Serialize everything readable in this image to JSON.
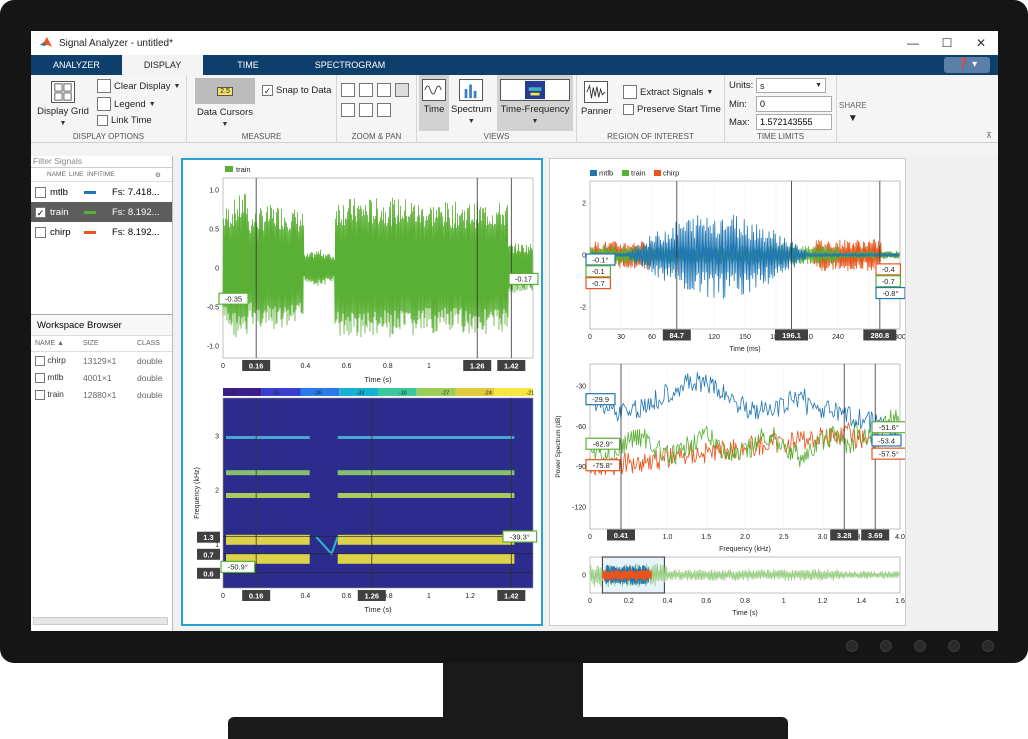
{
  "window": {
    "title": "Signal Analyzer - untitled*"
  },
  "tabs": [
    {
      "label": "ANALYZER"
    },
    {
      "label": "DISPLAY"
    },
    {
      "label": "TIME"
    },
    {
      "label": "SPECTROGRAM"
    }
  ],
  "ribbon": {
    "display_grid": "Display Grid",
    "clear_display": "Clear Display",
    "legend": "Legend",
    "link_time": "Link Time",
    "display_options": "DISPLAY OPTIONS",
    "data_cursors": "Data Cursors",
    "snap_to_data": "Snap to Data",
    "cursor_icon_value": "2.5",
    "measure": "MEASURE",
    "zoom_pan": "ZOOM & PAN",
    "time": "Time",
    "spectrum": "Spectrum",
    "time_frequency": "Time-Frequency",
    "views": "VIEWS",
    "panner": "Panner",
    "extract_signals": "Extract Signals",
    "preserve_start_time": "Preserve Start Time",
    "roi": "REGION OF INTEREST",
    "units_label": "Units:",
    "units_value": "s",
    "min_label": "Min:",
    "min_value": "0",
    "max_label": "Max:",
    "max_value": "1.572143555",
    "time_limits": "TIME LIMITS",
    "share": "SHARE"
  },
  "signals": {
    "filter_placeholder": "Filter Signals",
    "headers": [
      "NAME",
      "LINE",
      "INFO",
      "TIME"
    ],
    "rows": [
      {
        "name": "mtlb",
        "time": "Fs: 7.418...",
        "color": "#1f77b4",
        "checked": false
      },
      {
        "name": "train",
        "time": "Fs: 8.192...",
        "color": "#5ab034",
        "checked": true
      },
      {
        "name": "chirp",
        "time": "Fs: 8.192...",
        "color": "#e8541b",
        "checked": false
      }
    ]
  },
  "workspace": {
    "title": "Workspace Browser",
    "headers": [
      "NAME ▲",
      "SIZE",
      "CLASS"
    ],
    "rows": [
      {
        "name": "chirp",
        "size": "13129×1",
        "class": "double"
      },
      {
        "name": "mtlb",
        "size": "4001×1",
        "class": "double"
      },
      {
        "name": "train",
        "size": "12880×1",
        "class": "double"
      }
    ]
  },
  "plots": {
    "train_time": {
      "legend": "train",
      "xlabel": "Time (s)",
      "yticks": [
        "1.0",
        "0.5",
        "0",
        "-0.5",
        "-1.0"
      ],
      "xticks": [
        "0",
        "0.2",
        "0.4",
        "0.6",
        "0.8",
        "1",
        "1.2",
        "1.4"
      ],
      "cursor_labels": [
        "0.16",
        "1.26",
        "1.42"
      ],
      "value_labels": [
        "-0.35",
        "-0.17"
      ]
    },
    "spectrogram": {
      "xlabel": "Time (s)",
      "ylabel": "Frequency (kHz)",
      "colorbar_ticks": [
        "-42",
        "-39",
        "-36",
        "-33",
        "-30",
        "-27",
        "-24",
        "-21"
      ],
      "yticks": [
        "3",
        "2",
        "1"
      ],
      "xticks": [
        "0",
        "0.2",
        "0.4",
        "0.6",
        "0.8",
        "1",
        "1.2",
        "1.4"
      ],
      "cursor_x": [
        "0.16",
        "1.26",
        "1.42"
      ],
      "cursor_y": [
        "1.3",
        "0.7",
        "0.6"
      ],
      "value_labels": [
        "-50.9°",
        "-39.3°"
      ]
    },
    "multi_time": {
      "legend": [
        "mtlb",
        "train",
        "chirp"
      ],
      "xlabel": "Time (ms)",
      "yticks": [
        "2",
        "0",
        "-2"
      ],
      "xticks": [
        "0",
        "30",
        "60",
        "90",
        "120",
        "150",
        "180",
        "210",
        "240",
        "270",
        "300"
      ],
      "cursor_labels": [
        "84.7",
        "196.1",
        "280.8"
      ],
      "left_values": [
        "-0.1°",
        "-0.1",
        "-0.7"
      ],
      "right_values": [
        "-0.4",
        "-0.7",
        "-0.8°"
      ]
    },
    "spectrum": {
      "ylabel": "Power Spectrum (dB)",
      "xlabel": "Frequency (kHz)",
      "yticks": [
        "-30",
        "-60",
        "-90",
        "-120"
      ],
      "xticks": [
        "0",
        "0.5",
        "1.0",
        "1.5",
        "2.0",
        "2.5",
        "3.0",
        "3.5",
        "4.0"
      ],
      "cursor_labels": [
        "0.41",
        "3.28",
        "3.69"
      ],
      "left_values": [
        "-29.9",
        "-62.9°",
        "-75.8°"
      ],
      "right_values": [
        "-51.6°",
        "-53.4",
        "-57.5°"
      ]
    },
    "panner": {
      "xlabel": "Time (s)",
      "xticks": [
        "0",
        "0.2",
        "0.4",
        "0.6",
        "0.8",
        "1",
        "1.2",
        "1.4",
        "1.6"
      ],
      "ytick": "0"
    }
  },
  "colors": {
    "mtlb": "#1f77b4",
    "train": "#5ab034",
    "chirp": "#e8541b",
    "accent": "#0e3f6c",
    "cursor_label_bg": "#404040"
  }
}
